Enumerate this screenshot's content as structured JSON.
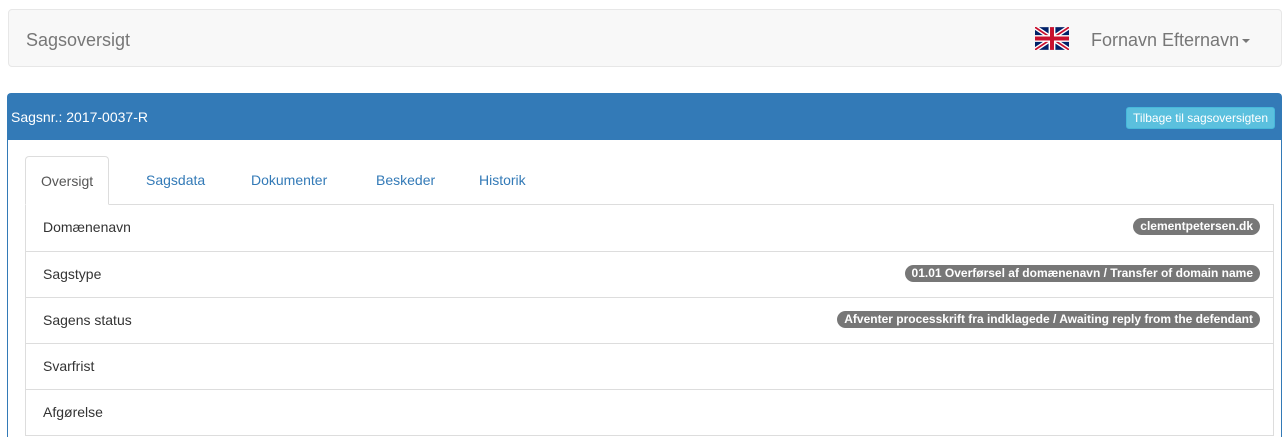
{
  "navbar": {
    "brand": "Sagsoversigt",
    "flag_icon": "uk-flag-icon",
    "user_name": "Fornavn Efternavn"
  },
  "panel": {
    "case_title": "Sagsnr.: 2017-0037-R",
    "back_button": "Tilbage til sagsoversigten",
    "tabs": [
      {
        "label": "Oversigt",
        "active": true
      },
      {
        "label": "Sagsdata",
        "active": false
      },
      {
        "label": "Dokumenter",
        "active": false
      },
      {
        "label": "Beskeder",
        "active": false
      },
      {
        "label": "Historik",
        "active": false
      }
    ],
    "rows": [
      {
        "label": "Domænenavn",
        "badge": "clementpetersen.dk"
      },
      {
        "label": "Sagstype",
        "badge": "01.01 Overførsel af domænenavn / Transfer of domain name"
      },
      {
        "label": "Sagens status",
        "badge": "Afventer processkrift fra indklagede / Awaiting reply from the defendant"
      },
      {
        "label": "Svarfrist",
        "badge": ""
      },
      {
        "label": "Afgørelse",
        "badge": ""
      }
    ]
  },
  "colors": {
    "primary": "#337ab7",
    "info_button": "#5bc0de",
    "badge": "#777777"
  }
}
